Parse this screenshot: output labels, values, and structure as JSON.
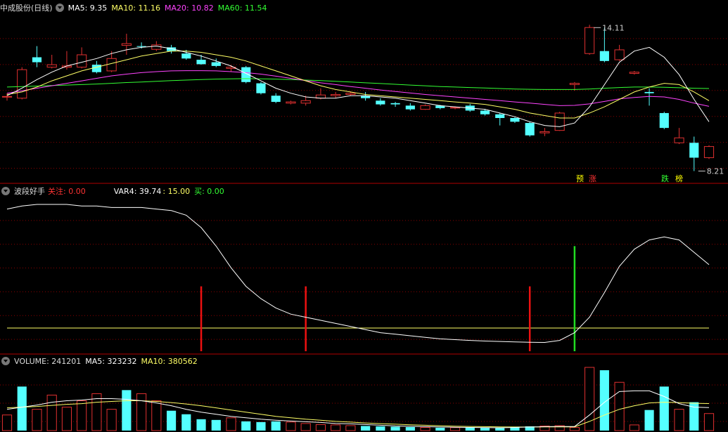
{
  "colors": {
    "up": "#e03030",
    "down": "#54ffff",
    "ma5": "#ffffff",
    "ma10": "#ffff66",
    "ma20": "#ff44ff",
    "ma60": "#33ff33",
    "label_red": "#ff3333",
    "label_green": "#33ff33",
    "label_yellow": "#ffff00",
    "grid": "#8a0000"
  },
  "panel1": {
    "title": "中成股份(日线)",
    "ma5": "MA5: 9.35",
    "ma10": "MA10: 11.16",
    "ma20": "MA20: 10.82",
    "ma60": "MA60: 11.54",
    "high_label": "14.11",
    "low_label": "8.21",
    "badges": [
      "预",
      "涨",
      "跌",
      "榜"
    ]
  },
  "panel2": {
    "title": "波段好手",
    "focus_label": "关注: 0.00",
    "var4_label": "VAR4: 39.74",
    "level_label": ": 15.00",
    "buy_label": "买: 0.00"
  },
  "panel3": {
    "volume_label": "VOLUME: 241201",
    "ma5_label": "MA5: 323232",
    "ma10_label": "MA10: 380562"
  },
  "chart_data": [
    {
      "type": "candlestick",
      "title": "中成股份(日线)",
      "price_range": [
        7.8,
        14.6
      ],
      "candles": [
        {
          "o": 11.2,
          "c": 11.22,
          "h": 11.35,
          "l": 11.05,
          "up": true
        },
        {
          "o": 11.15,
          "c": 12.3,
          "h": 12.4,
          "l": 11.1,
          "up": true
        },
        {
          "o": 12.8,
          "c": 12.6,
          "h": 13.25,
          "l": 12.4,
          "up": false
        },
        {
          "o": 12.4,
          "c": 12.5,
          "h": 12.9,
          "l": 12.35,
          "up": true
        },
        {
          "o": 12.4,
          "c": 12.45,
          "h": 13.05,
          "l": 12.3,
          "up": true
        },
        {
          "o": 12.4,
          "c": 12.9,
          "h": 13.2,
          "l": 12.35,
          "up": true
        },
        {
          "o": 12.5,
          "c": 12.2,
          "h": 12.65,
          "l": 12.15,
          "up": false
        },
        {
          "o": 12.25,
          "c": 12.75,
          "h": 13.05,
          "l": 12.2,
          "up": true
        },
        {
          "o": 13.28,
          "c": 13.35,
          "h": 13.75,
          "l": 12.9,
          "up": true
        },
        {
          "o": 13.25,
          "c": 13.22,
          "h": 13.4,
          "l": 13.15,
          "up": false
        },
        {
          "o": 13.12,
          "c": 13.3,
          "h": 13.45,
          "l": 13.05,
          "up": true
        },
        {
          "o": 13.2,
          "c": 13.05,
          "h": 13.3,
          "l": 12.95,
          "up": false
        },
        {
          "o": 12.95,
          "c": 12.75,
          "h": 13.1,
          "l": 12.7,
          "up": false
        },
        {
          "o": 12.7,
          "c": 12.52,
          "h": 12.9,
          "l": 12.5,
          "up": false
        },
        {
          "o": 12.6,
          "c": 12.45,
          "h": 12.75,
          "l": 12.4,
          "up": false
        },
        {
          "o": 12.4,
          "c": 12.35,
          "h": 12.48,
          "l": 12.22,
          "up": true
        },
        {
          "o": 12.4,
          "c": 11.8,
          "h": 12.45,
          "l": 11.75,
          "up": false
        },
        {
          "o": 11.75,
          "c": 11.35,
          "h": 11.8,
          "l": 11.3,
          "up": false
        },
        {
          "o": 11.25,
          "c": 11.0,
          "h": 11.35,
          "l": 10.95,
          "up": false
        },
        {
          "o": 10.95,
          "c": 11.0,
          "h": 11.05,
          "l": 10.9,
          "up": true
        },
        {
          "o": 10.95,
          "c": 11.05,
          "h": 11.25,
          "l": 10.85,
          "up": true
        },
        {
          "o": 11.15,
          "c": 11.28,
          "h": 11.55,
          "l": 11.1,
          "up": true
        },
        {
          "o": 11.25,
          "c": 11.3,
          "h": 11.4,
          "l": 11.15,
          "up": true
        },
        {
          "o": 11.3,
          "c": 11.35,
          "h": 11.42,
          "l": 11.25,
          "up": true
        },
        {
          "o": 11.25,
          "c": 11.15,
          "h": 11.4,
          "l": 11.05,
          "up": false
        },
        {
          "o": 11.05,
          "c": 10.9,
          "h": 11.15,
          "l": 10.85,
          "up": false
        },
        {
          "o": 10.95,
          "c": 10.9,
          "h": 11.0,
          "l": 10.8,
          "up": false
        },
        {
          "o": 10.85,
          "c": 10.7,
          "h": 10.95,
          "l": 10.65,
          "up": false
        },
        {
          "o": 10.7,
          "c": 10.85,
          "h": 10.9,
          "l": 10.68,
          "up": true
        },
        {
          "o": 10.85,
          "c": 10.75,
          "h": 10.88,
          "l": 10.7,
          "up": false
        },
        {
          "o": 10.75,
          "c": 10.78,
          "h": 10.82,
          "l": 10.7,
          "up": true
        },
        {
          "o": 10.85,
          "c": 10.65,
          "h": 10.92,
          "l": 10.6,
          "up": false
        },
        {
          "o": 10.65,
          "c": 10.5,
          "h": 10.72,
          "l": 10.45,
          "up": false
        },
        {
          "o": 10.5,
          "c": 10.35,
          "h": 10.55,
          "l": 10.05,
          "up": false
        },
        {
          "o": 10.35,
          "c": 10.2,
          "h": 10.38,
          "l": 10.15,
          "up": false
        },
        {
          "o": 10.15,
          "c": 9.65,
          "h": 10.2,
          "l": 9.6,
          "up": false
        },
        {
          "o": 9.75,
          "c": 9.8,
          "h": 9.95,
          "l": 9.62,
          "up": true
        },
        {
          "o": 9.85,
          "c": 10.55,
          "h": 10.6,
          "l": 9.83,
          "up": true
        },
        {
          "o": 11.7,
          "c": 11.75,
          "h": 11.8,
          "l": 11.45,
          "up": true
        },
        {
          "o": 12.95,
          "c": 14.0,
          "h": 14.11,
          "l": 12.9,
          "up": true
        },
        {
          "o": 13.05,
          "c": 12.65,
          "h": 14.0,
          "l": 12.6,
          "up": false
        },
        {
          "o": 12.7,
          "c": 13.1,
          "h": 13.3,
          "l": 12.65,
          "up": true
        },
        {
          "o": 12.15,
          "c": 12.2,
          "h": 12.25,
          "l": 12.1,
          "up": true
        },
        {
          "o": 11.4,
          "c": 11.35,
          "h": 11.55,
          "l": 10.85,
          "up": false
        },
        {
          "o": 10.55,
          "c": 9.95,
          "h": 10.6,
          "l": 9.9,
          "up": false
        },
        {
          "o": 9.35,
          "c": 9.55,
          "h": 9.95,
          "l": 9.3,
          "up": true
        },
        {
          "o": 9.35,
          "c": 8.75,
          "h": 9.6,
          "l": 8.21,
          "up": false
        },
        {
          "o": 8.75,
          "c": 9.2,
          "h": 9.25,
          "l": 8.7,
          "up": true
        }
      ],
      "ma5": [
        11.25,
        11.55,
        11.9,
        12.2,
        12.45,
        12.6,
        12.75,
        12.95,
        13.1,
        13.2,
        13.25,
        13.15,
        13.0,
        12.85,
        12.65,
        12.45,
        12.15,
        11.85,
        11.55,
        11.35,
        11.2,
        11.15,
        11.15,
        11.25,
        11.25,
        11.2,
        11.15,
        11.05,
        10.95,
        10.85,
        10.8,
        10.75,
        10.7,
        10.55,
        10.4,
        10.2,
        10.05,
        10.0,
        10.15,
        10.8,
        11.7,
        12.6,
        13.05,
        13.2,
        12.8,
        12.1,
        11.1,
        10.2
      ],
      "ma10": [
        11.3,
        11.4,
        11.6,
        11.85,
        12.05,
        12.25,
        12.4,
        12.55,
        12.7,
        12.85,
        12.95,
        13.05,
        13.05,
        13.0,
        12.9,
        12.8,
        12.65,
        12.45,
        12.25,
        12.05,
        11.85,
        11.65,
        11.5,
        11.4,
        11.3,
        11.25,
        11.2,
        11.15,
        11.1,
        11.05,
        11.0,
        10.95,
        10.9,
        10.8,
        10.7,
        10.55,
        10.45,
        10.35,
        10.35,
        10.55,
        10.8,
        11.1,
        11.4,
        11.6,
        11.75,
        11.7,
        11.4,
        11.05
      ],
      "ma20": [
        11.35,
        11.45,
        11.55,
        11.65,
        11.75,
        11.85,
        11.95,
        12.05,
        12.12,
        12.18,
        12.22,
        12.25,
        12.26,
        12.26,
        12.25,
        12.22,
        12.18,
        12.12,
        12.04,
        11.95,
        11.86,
        11.77,
        11.7,
        11.62,
        11.55,
        11.48,
        11.42,
        11.36,
        11.3,
        11.25,
        11.2,
        11.15,
        11.1,
        11.05,
        11.0,
        10.95,
        10.9,
        10.85,
        10.86,
        10.92,
        11.02,
        11.12,
        11.18,
        11.22,
        11.2,
        11.1,
        10.95,
        10.82
      ],
      "ma60": [
        11.6,
        11.62,
        11.64,
        11.66,
        11.68,
        11.7,
        11.72,
        11.75,
        11.78,
        11.8,
        11.83,
        11.86,
        11.88,
        11.9,
        11.92,
        11.93,
        11.94,
        11.93,
        11.92,
        11.9,
        11.88,
        11.86,
        11.83,
        11.8,
        11.77,
        11.74,
        11.71,
        11.68,
        11.65,
        11.62,
        11.6,
        11.58,
        11.56,
        11.54,
        11.52,
        11.51,
        11.5,
        11.5,
        11.5,
        11.52,
        11.55,
        11.58,
        11.6,
        11.6,
        11.59,
        11.57,
        11.55,
        11.54
      ]
    },
    {
      "type": "line",
      "title": "波段好手",
      "y_range": [
        0,
        100
      ],
      "var4": [
        92,
        94,
        95,
        95,
        95,
        94,
        94,
        93,
        93,
        93,
        92,
        91,
        88,
        80,
        68,
        54,
        42,
        34,
        28,
        24,
        22,
        20,
        18,
        16,
        14,
        12,
        11,
        10,
        9,
        8,
        7.5,
        7,
        6.6,
        6.3,
        6,
        5.8,
        5.7,
        7,
        12,
        22,
        38,
        55,
        66,
        72,
        74,
        72,
        64,
        56
      ],
      "level": 15,
      "signals": [
        {
          "index": 13,
          "color": "red",
          "value": 42
        },
        {
          "index": 20,
          "color": "red",
          "value": 42
        },
        {
          "index": 35,
          "color": "red",
          "value": 42
        },
        {
          "index": 38,
          "color": "green",
          "value": 68
        }
      ]
    },
    {
      "type": "bar",
      "title": "VOLUME",
      "y_range": [
        0,
        900000
      ],
      "volume": [
        220000,
        620000,
        300000,
        500000,
        330000,
        420000,
        520000,
        300000,
        570000,
        520000,
        420000,
        280000,
        230000,
        160000,
        150000,
        180000,
        130000,
        120000,
        130000,
        120000,
        100000,
        85000,
        80000,
        70000,
        65000,
        60000,
        55000,
        50000,
        45000,
        40000,
        42000,
        40000,
        38000,
        35000,
        55000,
        60000,
        65000,
        70000,
        45000,
        890000,
        850000,
        680000,
        80000,
        290000,
        620000,
        300000,
        400000,
        240000
      ],
      "vol_up": [
        true,
        false,
        true,
        true,
        true,
        true,
        true,
        true,
        false,
        true,
        true,
        false,
        false,
        false,
        false,
        true,
        false,
        false,
        false,
        true,
        true,
        true,
        true,
        true,
        false,
        false,
        false,
        false,
        true,
        false,
        true,
        false,
        false,
        false,
        false,
        false,
        true,
        true,
        true,
        true,
        false,
        true,
        true,
        false,
        false,
        true,
        false,
        true
      ],
      "vol_ma5": [
        300000,
        330000,
        360000,
        400000,
        420000,
        430000,
        450000,
        450000,
        440000,
        420000,
        390000,
        350000,
        300000,
        260000,
        230000,
        200000,
        180000,
        160000,
        145000,
        135000,
        125000,
        115000,
        100000,
        95000,
        85000,
        75000,
        65000,
        60000,
        55000,
        50000,
        47000,
        45000,
        42000,
        40000,
        45000,
        50000,
        55000,
        58000,
        57000,
        220000,
        400000,
        550000,
        560000,
        560000,
        480000,
        380000,
        330000,
        323232
      ],
      "vol_ma10": [
        320000,
        330000,
        340000,
        355000,
        370000,
        380000,
        400000,
        410000,
        420000,
        420000,
        410000,
        395000,
        375000,
        350000,
        320000,
        290000,
        260000,
        230000,
        200000,
        180000,
        160000,
        145000,
        130000,
        120000,
        108000,
        98000,
        90000,
        82000,
        75000,
        68000,
        62000,
        58000,
        55000,
        52000,
        50000,
        50000,
        51000,
        52000,
        52000,
        130000,
        220000,
        300000,
        350000,
        390000,
        400000,
        395000,
        385000,
        380562
      ]
    }
  ]
}
